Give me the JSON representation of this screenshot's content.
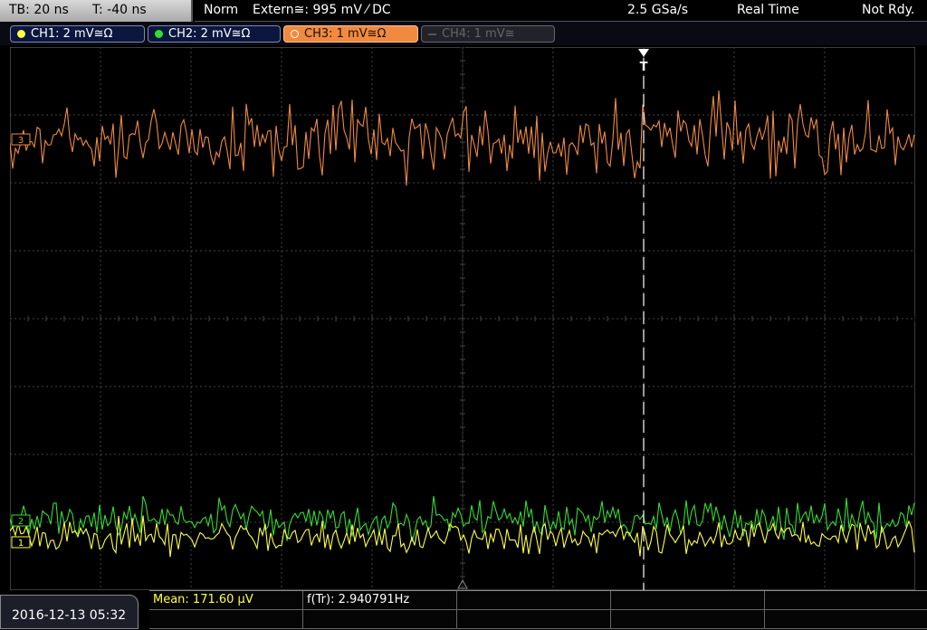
{
  "status_bar": {
    "timebase": "TB: 20 ns",
    "time_offset": "T: -40 ns",
    "trigger_mode": "Norm",
    "trigger_source": "Extern≅: 995 mV ⁄ DC",
    "sample_rate": "2.5 GSa/s",
    "acq_mode": "Real Time",
    "state": "Not Rdy."
  },
  "channels": [
    {
      "label": "CH1: 2 mV≅Ω",
      "color": "#ffff44",
      "active": true
    },
    {
      "label": "CH2: 2 mV≅Ω",
      "color": "#33dd33",
      "active": true
    },
    {
      "label": "CH3: 1 mV≅Ω",
      "color": "#f08a40",
      "active": true,
      "selected": true
    },
    {
      "label": "CH4: 1 mV≅",
      "color": "#555555",
      "active": false
    }
  ],
  "markers": {
    "trigger": "T",
    "ch3": "3",
    "ch1": "1",
    "ch2": "2"
  },
  "measurements": {
    "mean": "Mean: 171.60 µV",
    "freq": "f(Tr): 2.940791Hz"
  },
  "datetime": "2016-12-13 05:32",
  "colors": {
    "ch1": "#ffff44",
    "ch2": "#33dd33",
    "ch3": "#f08a40",
    "grid": "#3c3c3c",
    "background": "#000000"
  }
}
